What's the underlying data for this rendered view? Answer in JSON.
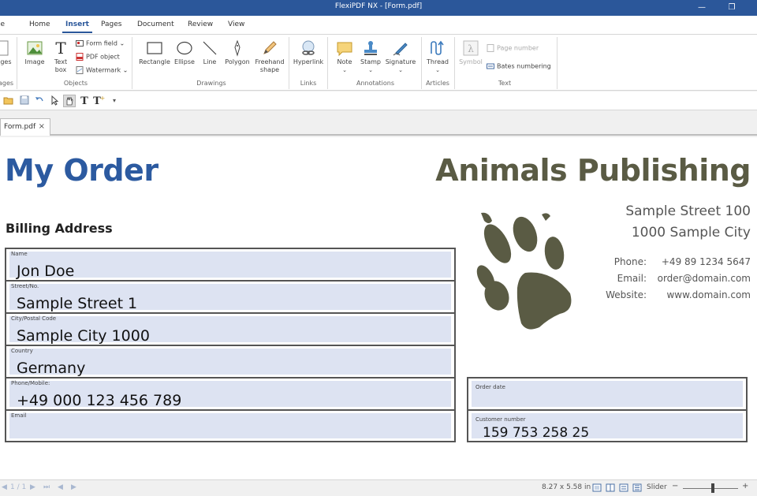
{
  "window": {
    "title": "FlexiPDF NX - [Form.pdf]",
    "minimize_glyph": "—",
    "restore_glyph": "❐"
  },
  "menu": {
    "tabs": [
      {
        "label": "le"
      },
      {
        "label": "Home"
      },
      {
        "label": "Insert",
        "active": true
      },
      {
        "label": "Pages"
      },
      {
        "label": "Document"
      },
      {
        "label": "Review"
      },
      {
        "label": "View"
      }
    ]
  },
  "ribbon": {
    "groups": {
      "pages": {
        "label": "ages",
        "button": "ages"
      },
      "objects": {
        "label": "Objects",
        "image": "Image",
        "textbox": "Text box",
        "form_field": "Form field",
        "pdf_object": "PDF object",
        "watermark": "Watermark"
      },
      "drawings": {
        "label": "Drawings",
        "rectangle": "Rectangle",
        "ellipse": "Ellipse",
        "line": "Line",
        "polygon": "Polygon",
        "freehand": "Freehand shape"
      },
      "links": {
        "label": "Links",
        "hyperlink": "Hyperlink"
      },
      "annotations": {
        "label": "Annotations",
        "note": "Note",
        "stamp": "Stamp",
        "signature": "Signature"
      },
      "articles": {
        "label": "Articles",
        "thread": "Thread"
      },
      "text": {
        "label": "Text",
        "symbol": "Symbol",
        "page_number": "Page number",
        "bates": "Bates numbering"
      }
    }
  },
  "document_tab": {
    "label": "Form.pdf",
    "close": "×"
  },
  "page": {
    "heading": "My Order",
    "company": "Animals Publishing",
    "billing_heading": "Billing Address",
    "address_line1": "Sample Street 100",
    "address_line2": "1000 Sample City",
    "contacts": [
      {
        "label": "Phone:",
        "value": "+49 89 1234 5647"
      },
      {
        "label": "Email:",
        "value": "order@domain.com"
      },
      {
        "label": "Website:",
        "value": "www.domain.com"
      }
    ],
    "billing_fields": [
      {
        "label": "Name",
        "value": "Jon Doe"
      },
      {
        "label": "Street/No.",
        "value": "Sample Street 1"
      },
      {
        "label": "City/Postal Code",
        "value": "Sample City 1000"
      },
      {
        "label": "Country",
        "value": "Germany"
      },
      {
        "label": "Phone/Mobile:",
        "value": "+49 000 123 456 789"
      },
      {
        "label": "Email",
        "value": ""
      }
    ],
    "order_fields": [
      {
        "label": "Order date",
        "value": ""
      },
      {
        "label": "Customer number",
        "value": "159 753 258 25"
      }
    ],
    "colors": {
      "heading": "#2c5aa0",
      "company": "#5a5b44",
      "field_fill": "#dde3f2"
    }
  },
  "status": {
    "page_indicator": "1 / 1",
    "page_size": "8.27 x 5.58 in",
    "zoom_mode": "Slider",
    "zoom_out": "−",
    "zoom_in": "+"
  }
}
